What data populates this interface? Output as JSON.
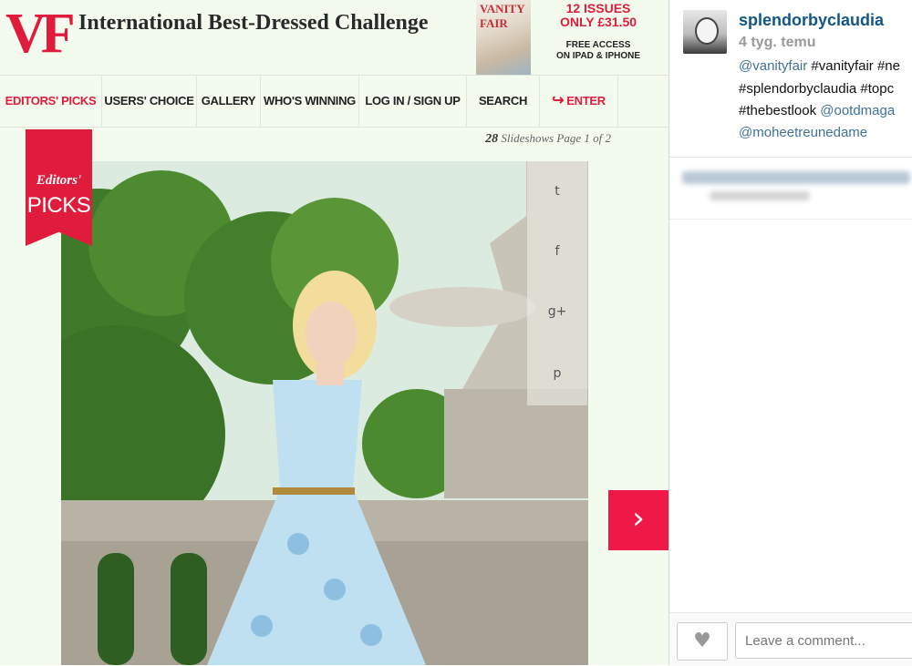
{
  "site": {
    "logo": "VF",
    "title": "International Best-Dressed Challenge"
  },
  "ad": {
    "cover_title": "VANITY FAIR",
    "line1": "12 ISSUES",
    "line2": "ONLY £31.50",
    "line3": "FREE ACCESS",
    "line4": "ON IPAD & IPHONE"
  },
  "nav": {
    "items": [
      {
        "label": "EDITORS' PICKS",
        "active": true
      },
      {
        "label": "USERS' CHOICE"
      },
      {
        "label": "GALLERY"
      },
      {
        "label": "WHO'S WINNING"
      },
      {
        "label": "LOG IN / SIGN UP"
      },
      {
        "label": "SEARCH"
      },
      {
        "label": "ENTER",
        "icon": "arrow-enter-icon"
      }
    ]
  },
  "slides": {
    "count": "28",
    "label": "Slideshows Page 1 of 2"
  },
  "ribbon": {
    "line1": "Editors'",
    "line2": "PICKS"
  },
  "share": {
    "icons": [
      "twitter-icon",
      "facebook-icon",
      "google-plus-icon",
      "pinterest-icon"
    ],
    "glyphs": [
      "t",
      "f",
      "g+",
      "p"
    ]
  },
  "next": {
    "glyph": "›"
  },
  "post": {
    "username": "splendorbyclaudia",
    "time": "4 tyg. temu",
    "caption": {
      "l1_mention": "@vanityfair",
      "l1_rest": " #vanityfair #ne",
      "l2": "#splendorbyclaudia #topc",
      "l3_tag": "#thebestlook",
      "l3_mention": " @ootdmaga",
      "l4_mention": "@moheetreunedame"
    },
    "comment_placeholder": "Leave a comment..."
  },
  "colors": {
    "accent": "#e01b3c",
    "link": "#125688",
    "mention": "#3f729b",
    "page_bg": "#f3fbef"
  }
}
